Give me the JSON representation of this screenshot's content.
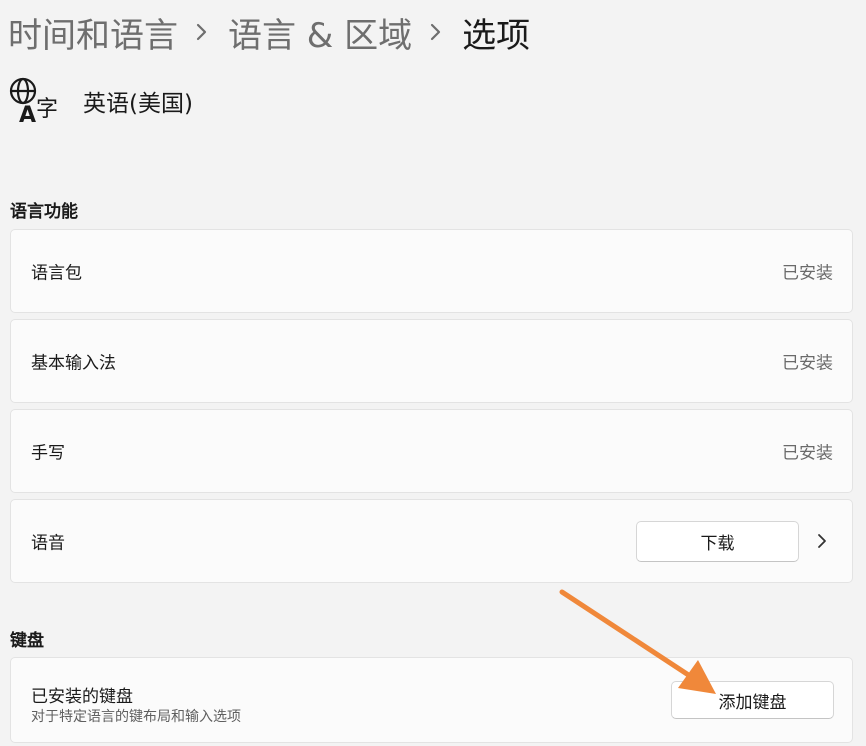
{
  "breadcrumb": {
    "items": [
      "时间和语言",
      "语言 & 区域",
      "选项"
    ],
    "separator": "›"
  },
  "language": {
    "name": "英语(美国)",
    "icon": "language-globe-icon"
  },
  "sections": {
    "features": {
      "title": "语言功能",
      "rows": [
        {
          "label": "语言包",
          "status": "已安装"
        },
        {
          "label": "基本输入法",
          "status": "已安装"
        },
        {
          "label": "手写",
          "status": "已安装"
        }
      ],
      "speech": {
        "label": "语音",
        "button": "下载",
        "chevron": "chevron-right-icon"
      }
    },
    "keyboard": {
      "title": "键盘",
      "installed": {
        "title": "已安装的键盘",
        "subtitle": "对于特定语言的键布局和输入选项",
        "button": "添加键盘"
      }
    }
  },
  "colors": {
    "background": "#f3f3f3",
    "card": "#fbfbfb",
    "annotation_arrow": "#f0883a"
  }
}
